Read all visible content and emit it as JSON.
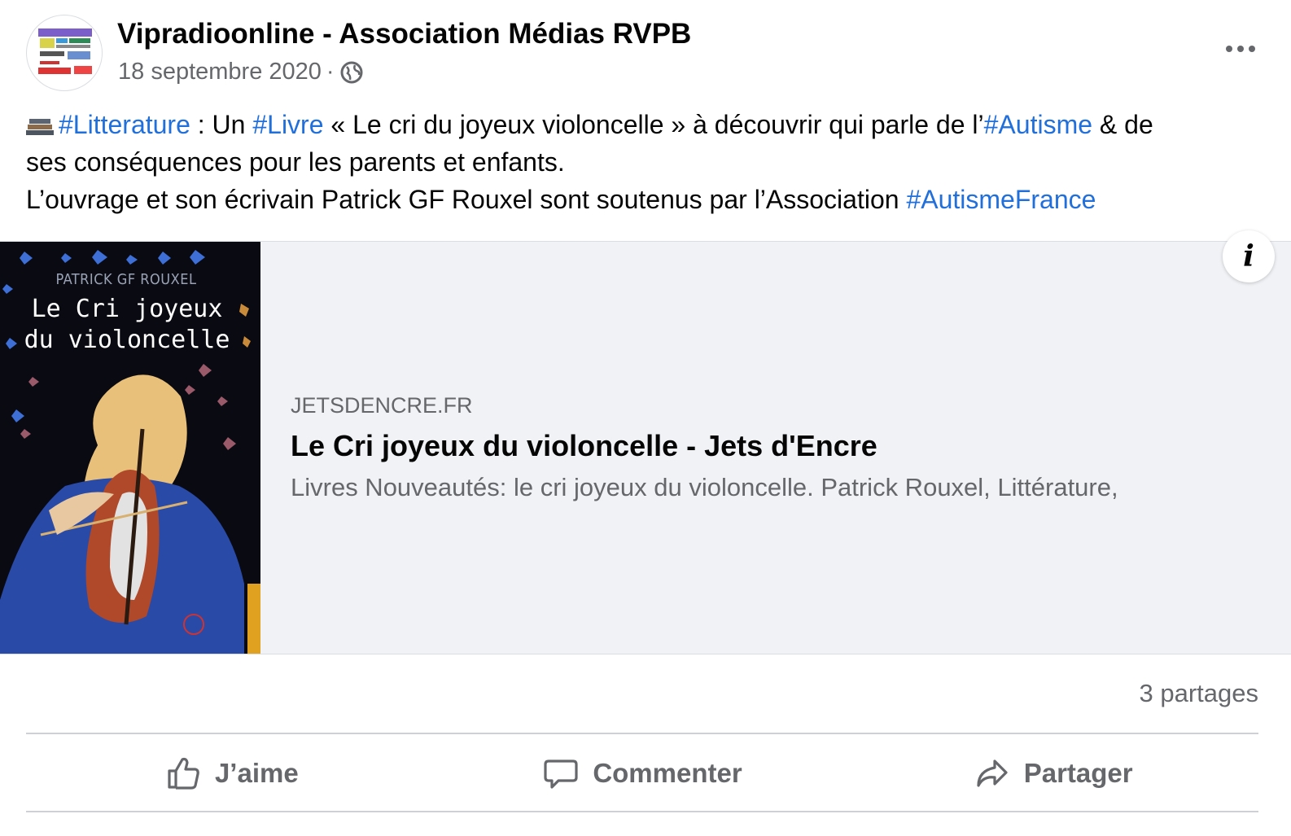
{
  "post": {
    "author": "Vipradioonline - Association Médias RVPB",
    "date": "18 septembre 2020",
    "separator": "·",
    "icons": {
      "visibility": "globe-icon",
      "menu": "more-options-icon",
      "emoji": "books-icon"
    },
    "text": {
      "line1": {
        "hashtag1": "#Litterature",
        "part1": " : Un ",
        "hashtag2": "#Livre",
        "part2": " « Le cri du joyeux violoncelle » à découvrir qui parle de l’",
        "hashtag3": "#Autisme",
        "part3": " & de"
      },
      "line2": "ses conséquences pour les parents et enfants.",
      "line3": {
        "part1": "L’ouvrage et son écrivain Patrick GF Rouxel sont soutenus par l’Association ",
        "hashtag": "#AutismeFrance"
      }
    }
  },
  "link_preview": {
    "thumbnail": {
      "author": "PATRICK GF ROUXEL",
      "title_line1": "Le Cri joyeux",
      "title_line2": "du violoncelle"
    },
    "info_label": "i",
    "domain": "JETSDENCRE.FR",
    "title": "Le Cri joyeux du violoncelle - Jets d'Encre",
    "description": "Livres Nouveautés: le cri joyeux du violoncelle. Patrick Rouxel, Littérature,"
  },
  "stats": {
    "shares": "3 partages"
  },
  "actions": {
    "like": "J’aime",
    "comment": "Commenter",
    "share": "Partager"
  },
  "colors": {
    "hashtag": "#216fdb",
    "secondary_text": "#65676b",
    "card_background": "#f0f2f5"
  }
}
